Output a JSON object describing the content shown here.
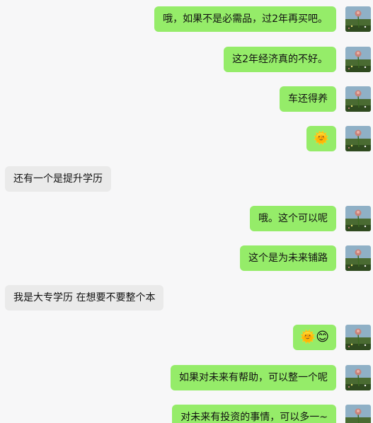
{
  "messages": [
    {
      "side": "out",
      "text": "哦，如果不是必需品，过2年再买吧。"
    },
    {
      "side": "out",
      "text": "这2年经济真的不好。"
    },
    {
      "side": "out",
      "text": "车还得养"
    },
    {
      "side": "out",
      "text": "🌞"
    },
    {
      "side": "in",
      "text": "还有一个是提升学历"
    },
    {
      "side": "out",
      "text": "哦。这个可以呢"
    },
    {
      "side": "out",
      "text": "这个是为未来铺路"
    },
    {
      "side": "in",
      "text": "我是大专学历 在想要不要整个本"
    },
    {
      "side": "out",
      "text": "🌞😊"
    },
    {
      "side": "out",
      "text": "如果对未来有帮助，可以整一个呢"
    },
    {
      "side": "out",
      "text": "对未来有投资的事情，可以多一~"
    }
  ],
  "colors": {
    "outgoing_bubble": "#95ec69",
    "incoming_bubble": "#eaeaea",
    "background": "#f7f7f8"
  },
  "avatar_icon": "flower-landscape-avatar-icon"
}
